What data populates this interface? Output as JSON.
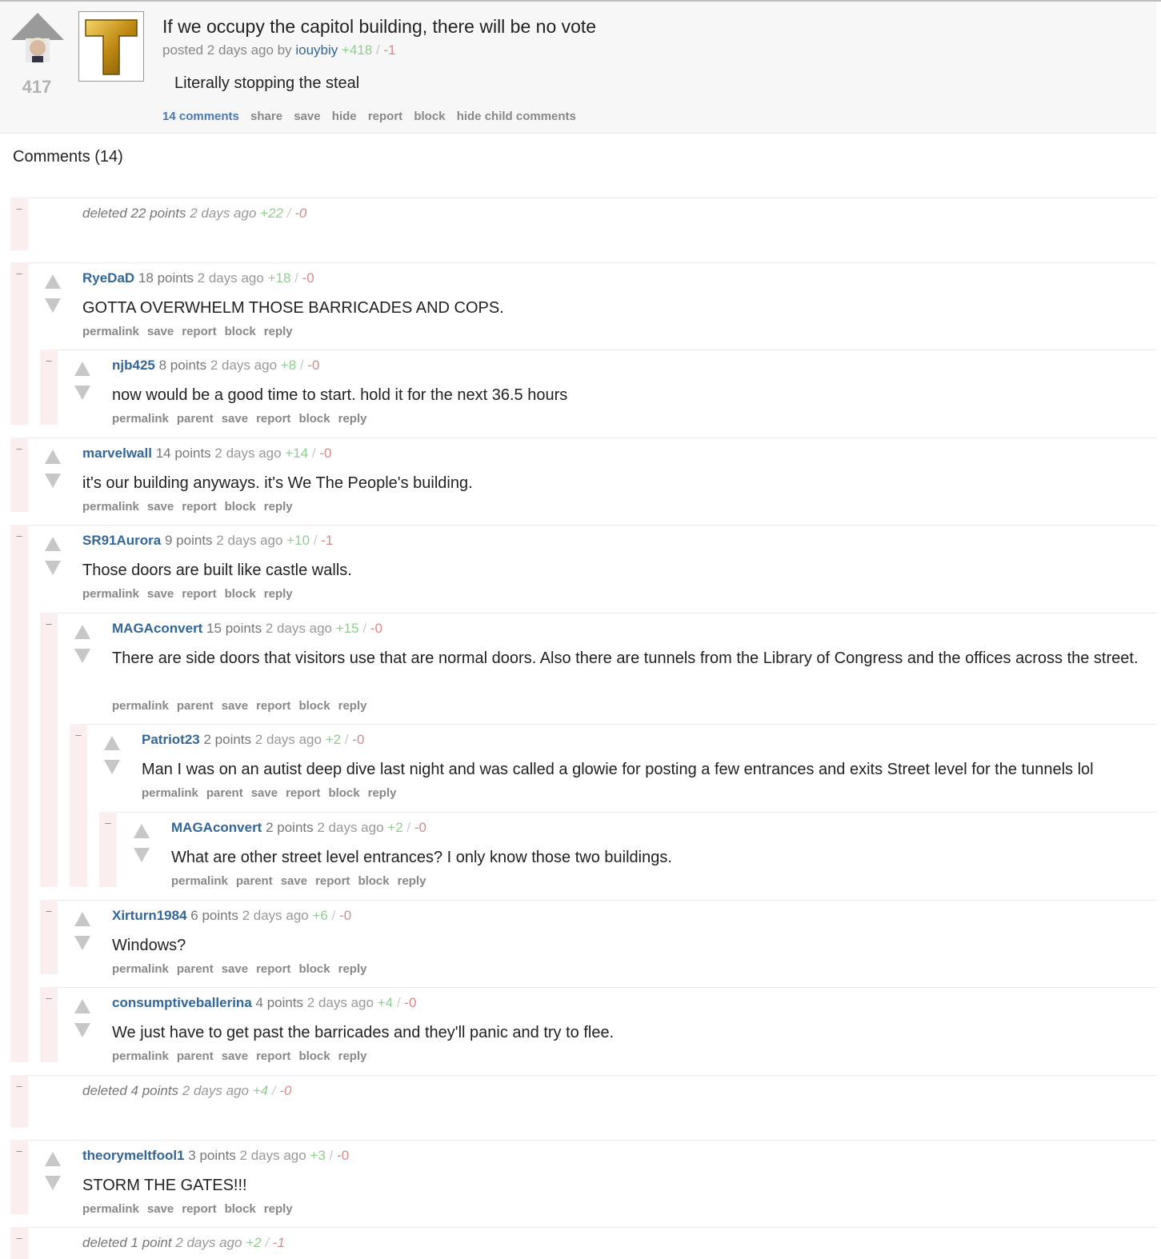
{
  "colors": {
    "user_link": "#336699",
    "upvote_count": "#8ecf8e",
    "downvote_count": "#d88a8a",
    "comment_gutter": "#fbeeee",
    "post_background": "#f7f7f7"
  },
  "post": {
    "score": "417",
    "title": "If we occupy the capitol building, there will be no vote",
    "meta_prefix": "posted 2 days ago by",
    "author": "iouybiy",
    "upvotes": "+418",
    "slash": "/",
    "downvotes": "-1",
    "body": "Literally stopping the steal",
    "actions": {
      "comments": "14 comments",
      "share": "share",
      "save": "save",
      "hide": "hide",
      "report": "report",
      "block": "block",
      "hide_children": "hide child comments"
    }
  },
  "comments_heading": "Comments (14)",
  "comments": [
    {
      "deleted": true,
      "user": "deleted",
      "points": "22 points",
      "age": "2 days ago",
      "up": "+22",
      "down": "-0"
    },
    {
      "user": "RyeDaD",
      "points": "18 points",
      "age": "2 days ago",
      "up": "+18",
      "down": "-0",
      "body": "GOTTA OVERWHELM THOSE BARRICADES AND COPS.",
      "actions": [
        "permalink",
        "save",
        "report",
        "block",
        "reply"
      ]
    },
    {
      "user": "njb425",
      "points": "8 points",
      "age": "2 days ago",
      "up": "+8",
      "down": "-0",
      "body": "now would be a good time to start. hold it for the next 36.5 hours",
      "actions": [
        "permalink",
        "parent",
        "save",
        "report",
        "block",
        "reply"
      ]
    },
    {
      "user": "marvelwall",
      "points": "14 points",
      "age": "2 days ago",
      "up": "+14",
      "down": "-0",
      "body": "it's our building anyways. it's We The People's building.",
      "actions": [
        "permalink",
        "save",
        "report",
        "block",
        "reply"
      ]
    },
    {
      "user": "SR91Aurora",
      "points": "9 points",
      "age": "2 days ago",
      "up": "+10",
      "down": "-1",
      "body": "Those doors are built like castle walls.",
      "actions": [
        "permalink",
        "save",
        "report",
        "block",
        "reply"
      ]
    },
    {
      "user": "MAGAconvert",
      "points": "15 points",
      "age": "2 days ago",
      "up": "+15",
      "down": "-0",
      "body": "There are side doors that visitors use that are normal doors. Also there are tunnels from the Library of Congress and the offices across the street.",
      "actions": [
        "permalink",
        "parent",
        "save",
        "report",
        "block",
        "reply"
      ]
    },
    {
      "user": "Patriot23",
      "points": "2 points",
      "age": "2 days ago",
      "up": "+2",
      "down": "-0",
      "body": "Man I was on an autist deep dive last night and was called a glowie for posting a few entrances and exits Street level for the tunnels lol",
      "actions": [
        "permalink",
        "parent",
        "save",
        "report",
        "block",
        "reply"
      ]
    },
    {
      "user": "MAGAconvert",
      "points": "2 points",
      "age": "2 days ago",
      "up": "+2",
      "down": "-0",
      "body": "What are other street level entrances? I only know those two buildings.",
      "actions": [
        "permalink",
        "parent",
        "save",
        "report",
        "block",
        "reply"
      ]
    },
    {
      "user": "Xirturn1984",
      "points": "6 points",
      "age": "2 days ago",
      "up": "+6",
      "down": "-0",
      "body": "Windows?",
      "actions": [
        "permalink",
        "parent",
        "save",
        "report",
        "block",
        "reply"
      ]
    },
    {
      "user": "consumptiveballerina",
      "points": "4 points",
      "age": "2 days ago",
      "up": "+4",
      "down": "-0",
      "body": "We just have to get past the barricades and they'll panic and try to flee.",
      "actions": [
        "permalink",
        "parent",
        "save",
        "report",
        "block",
        "reply"
      ]
    },
    {
      "deleted": true,
      "user": "deleted",
      "points": "4 points",
      "age": "2 days ago",
      "up": "+4",
      "down": "-0"
    },
    {
      "user": "theorymeltfool1",
      "points": "3 points",
      "age": "2 days ago",
      "up": "+3",
      "down": "-0",
      "body": "STORM THE GATES!!!",
      "actions": [
        "permalink",
        "save",
        "report",
        "block",
        "reply"
      ]
    },
    {
      "deleted": true,
      "user": "deleted",
      "points": "1 point",
      "age": "2 days ago",
      "up": "+2",
      "down": "-1"
    }
  ]
}
